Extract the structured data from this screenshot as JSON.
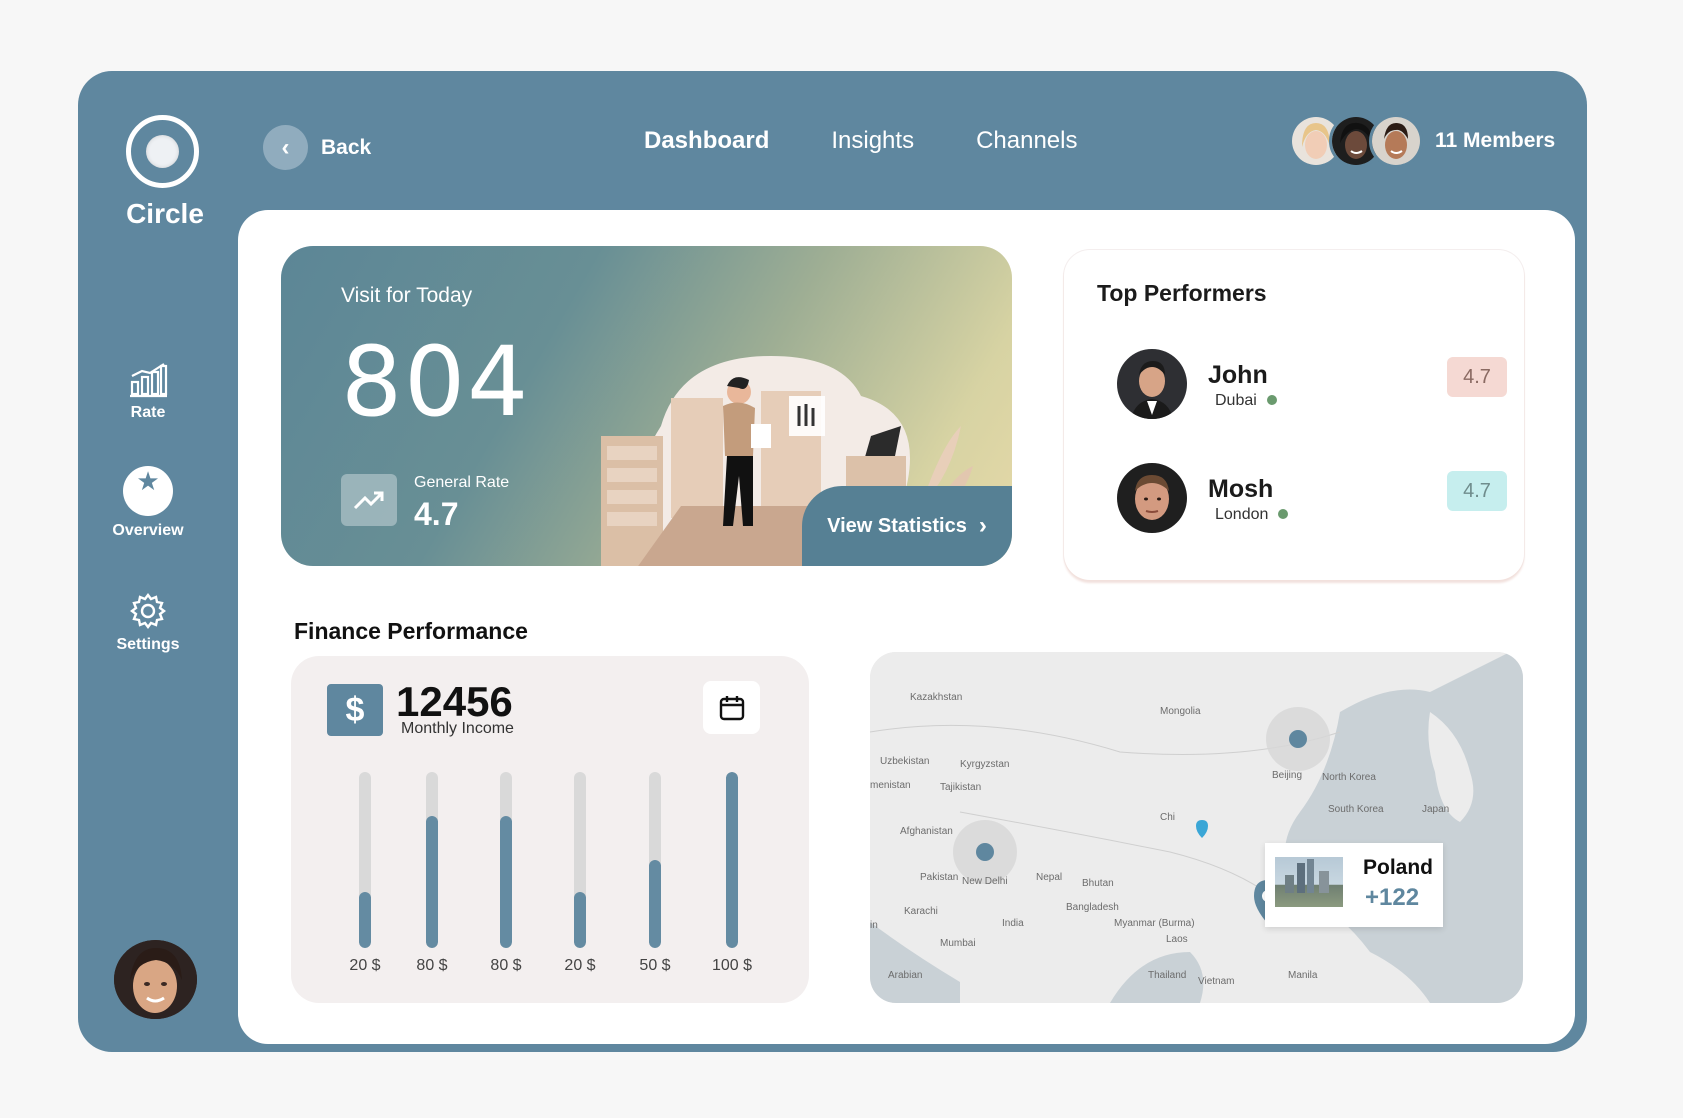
{
  "app": {
    "name": "Circle"
  },
  "sidebar": {
    "items": [
      {
        "label": "Rate",
        "icon": "bar-chart-icon"
      },
      {
        "label": "Overview",
        "icon": "star-icon"
      },
      {
        "label": "Settings",
        "icon": "gear-icon"
      }
    ]
  },
  "header": {
    "back_label": "Back",
    "tabs": [
      {
        "label": "Dashboard",
        "active": true
      },
      {
        "label": "Insights",
        "active": false
      },
      {
        "label": "Channels",
        "active": false
      }
    ],
    "members_label": "11 Members"
  },
  "visit": {
    "label": "Visit for Today",
    "value": "804",
    "rate_label": "General Rate",
    "rate_value": "4.7",
    "view_button": "View Statistics"
  },
  "performers": {
    "title": "Top Performers",
    "list": [
      {
        "name": "John",
        "city": "Dubai",
        "score": "4.7"
      },
      {
        "name": "Mosh",
        "city": "London",
        "score": "4.7"
      }
    ]
  },
  "finance": {
    "title": "Finance Performance",
    "income_value": "12456",
    "income_label": "Monthly Income",
    "currency_symbol": "$",
    "bars": [
      {
        "label": "20 $",
        "fill": 0.32
      },
      {
        "label": "80 $",
        "fill": 0.75
      },
      {
        "label": "80 $",
        "fill": 0.75
      },
      {
        "label": "20 $",
        "fill": 0.32
      },
      {
        "label": "50 $",
        "fill": 0.5
      },
      {
        "label": "100 $",
        "fill": 1.0
      }
    ]
  },
  "map": {
    "labels": [
      "Kazakhstan",
      "Mongolia",
      "Uzbekistan",
      "Kyrgyzstan",
      "menistan",
      "Tajikistan",
      "Beijing",
      "North Korea",
      "South Korea",
      "Japan",
      "Afghanistan",
      "Chi",
      "Pakistan",
      "New Delhi",
      "Nepal",
      "Bhutan",
      "Bangladesh",
      "Karachi",
      "India",
      "Myanmar (Burma)",
      "Laos",
      "Mumbai",
      "Thailand",
      "Vietnam",
      "Arabian",
      "Manila",
      "in"
    ],
    "location": {
      "name": "Poland",
      "value": "+122"
    }
  },
  "colors": {
    "primary": "#5f879f",
    "background": "#f7f7f7",
    "accent_green": "#6a9a6e"
  }
}
